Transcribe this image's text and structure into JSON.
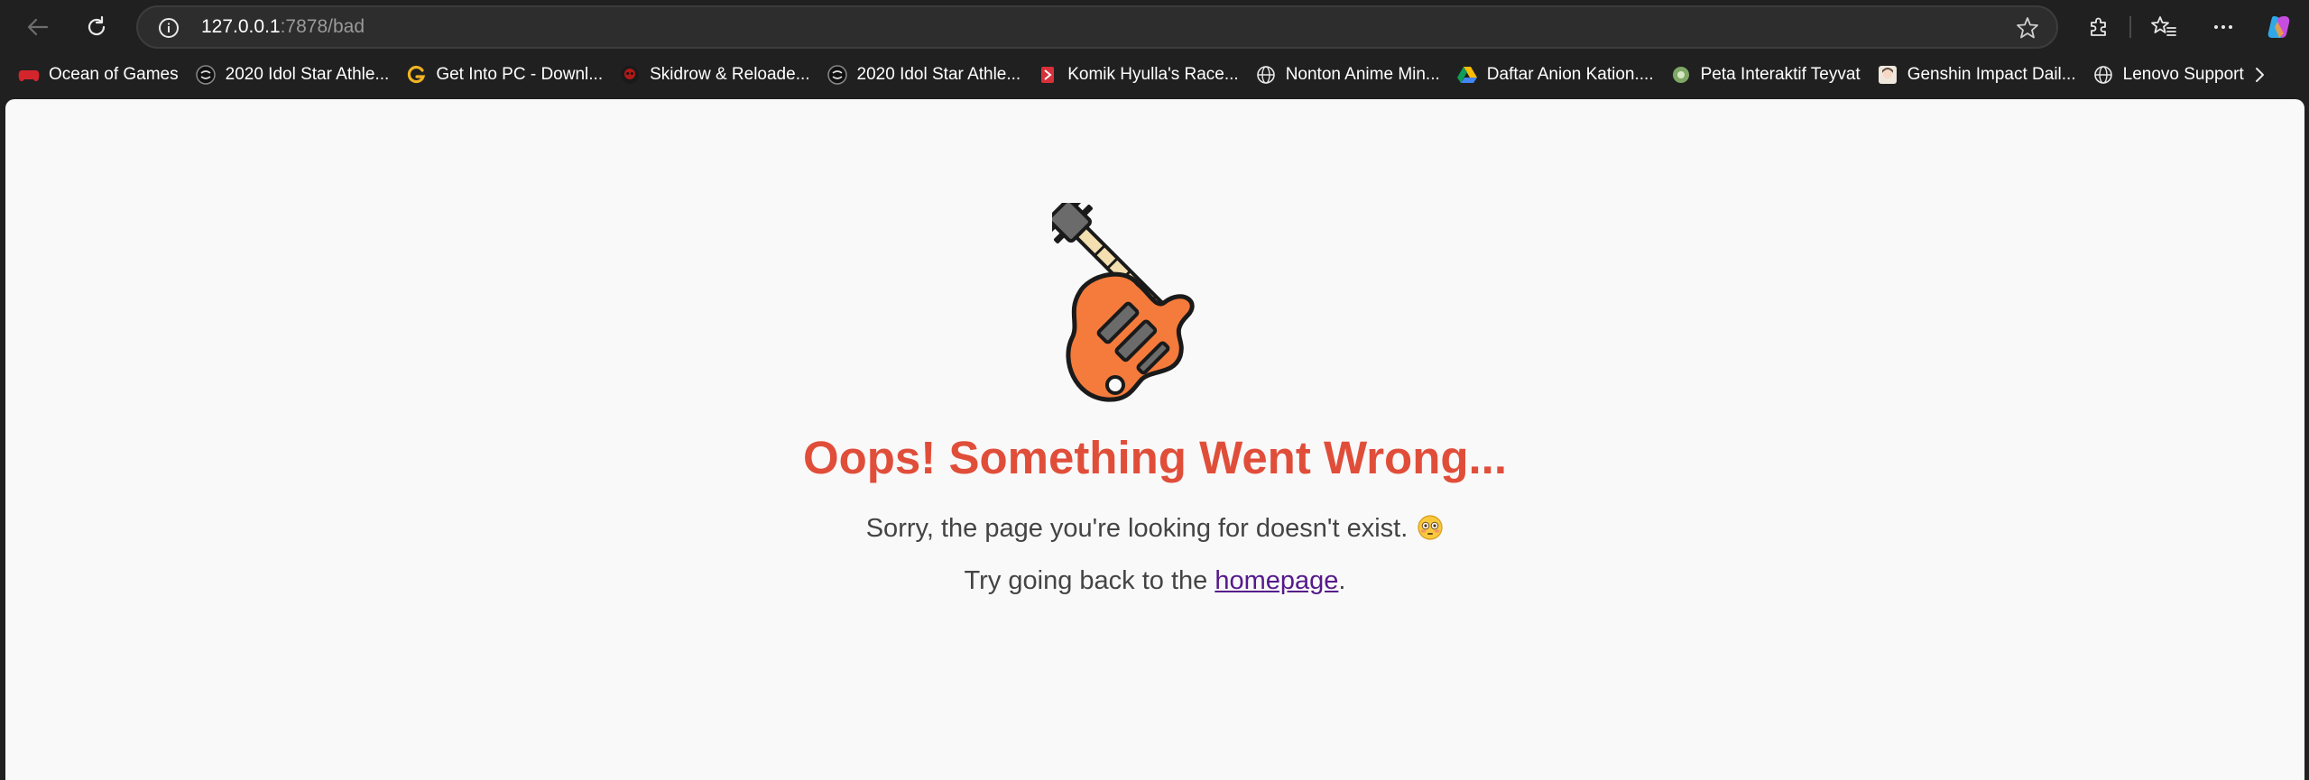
{
  "browser": {
    "address": {
      "host": "127.0.0.1",
      "path": ":7878/bad"
    }
  },
  "bookmarks": [
    {
      "label": "Ocean of Games",
      "icon": "red-gamepad-icon"
    },
    {
      "label": "2020 Idol Star Athle...",
      "icon": "dark-circle-logo-icon"
    },
    {
      "label": "Get Into PC - Downl...",
      "icon": "yellow-g-icon"
    },
    {
      "label": "Skidrow & Reloade...",
      "icon": "red-skull-icon"
    },
    {
      "label": "2020 Idol Star Athle...",
      "icon": "dark-circle-logo-icon"
    },
    {
      "label": "Komik Hyulla's Race...",
      "icon": "red-book-icon"
    },
    {
      "label": "Nonton Anime Min...",
      "icon": "globe-icon"
    },
    {
      "label": "Daftar Anion Kation....",
      "icon": "google-drive-icon"
    },
    {
      "label": "Peta Interaktif Teyvat",
      "icon": "green-map-icon"
    },
    {
      "label": "Genshin Impact Dail...",
      "icon": "anime-avatar-icon"
    },
    {
      "label": "Lenovo Support",
      "icon": "globe-icon"
    }
  ],
  "page": {
    "title": "Oops! Something Went Wrong...",
    "message": "Sorry, the page you're looking for doesn't exist.",
    "back_prefix": "Try going back to the ",
    "back_link": "homepage",
    "back_suffix": ".",
    "illustration": "guitar-icon",
    "emoji": "flushed-face-emoji"
  },
  "colors": {
    "title": "#e04e3a",
    "text": "#444444",
    "link": "#551a8b",
    "page_bg": "#f9f9f9",
    "chrome_bg": "#202020"
  }
}
